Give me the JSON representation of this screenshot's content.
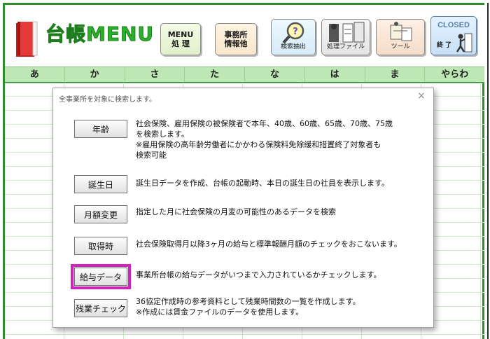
{
  "header": {
    "logo_text": "台帳MENU",
    "buttons": {
      "menu": "MENU\n処 理",
      "office": "事務所\n情報他",
      "search": "検索抽出",
      "files": "処理ファイル",
      "tools": "ツール",
      "closed_title": "CLOSED",
      "closed_sub": "終 了"
    }
  },
  "index_bar": [
    "あ",
    "か",
    "さ",
    "た",
    "な",
    "は",
    "ま",
    "やらわ"
  ],
  "dialog": {
    "title": "全事業所を対象に検索します。",
    "close": "×",
    "rows": [
      {
        "label": "年齢",
        "desc": "社会保険、雇用保険の被保険者で本年、40歳、60歳、65歳、70歳、75歳\nを検索します。\n※雇用保険の高年齢労働者にかかわる保険料免除緩和措置終了対象者も\n検索可能"
      },
      {
        "label": "誕生日",
        "desc": "誕生日データを作成、台帳の起動時、本日の誕生日の社員を表示します。"
      },
      {
        "label": "月額変更",
        "desc": "指定した月に社会保険の月変の可能性のあるデータを検索"
      },
      {
        "label": "取得時",
        "desc": "社会保険取得月以降3ヶ月の給与と標準報酬月額のチェックをおこないます。"
      },
      {
        "label": "給与データ",
        "desc": "事業所台帳の給与データがいつまで入力されているかチェックします。"
      },
      {
        "label": "残業チェック",
        "desc": "36協定作成時の参考資料として残業時間数の一覧を作成します。\n※作成には賃金ファイルのデータを使用します。"
      }
    ]
  }
}
